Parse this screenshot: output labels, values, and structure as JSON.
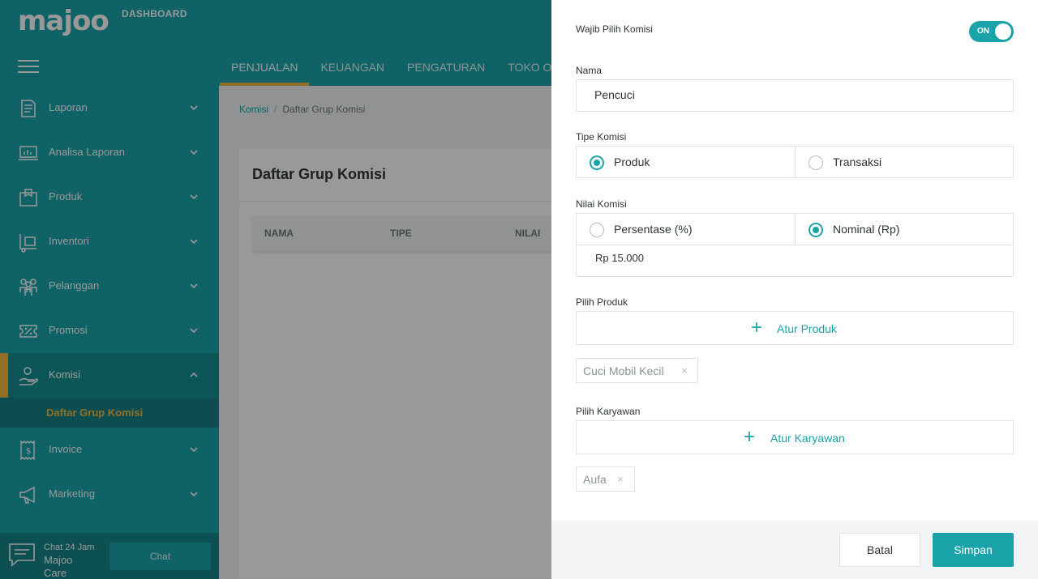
{
  "brand": {
    "logo": "majoo",
    "subtitle": "DASHBOARD"
  },
  "colors": {
    "primary": "#1aa3a8",
    "accent": "#f4b942",
    "overlay": "rgba(0,0,0,0.4)"
  },
  "topnav": [
    {
      "label": "PENJUALAN",
      "active": true
    },
    {
      "label": "KEUANGAN",
      "active": false
    },
    {
      "label": "PENGATURAN",
      "active": false
    },
    {
      "label": "TOKO ONL",
      "active": false
    }
  ],
  "sidebar": {
    "items": [
      {
        "label": "Laporan",
        "icon": "report-icon"
      },
      {
        "label": "Analisa Laporan",
        "icon": "analytics-icon"
      },
      {
        "label": "Produk",
        "icon": "box-icon"
      },
      {
        "label": "Inventori",
        "icon": "inventory-icon"
      },
      {
        "label": "Pelanggan",
        "icon": "customers-icon"
      },
      {
        "label": "Promosi",
        "icon": "coupon-icon"
      },
      {
        "label": "Komisi",
        "icon": "commission-icon",
        "active": true
      },
      {
        "label": "Invoice",
        "icon": "invoice-icon"
      },
      {
        "label": "Marketing",
        "icon": "megaphone-icon"
      }
    ],
    "submenu": {
      "label": "Daftar Grup Komisi"
    },
    "chat": {
      "line1": "Chat 24 Jam",
      "line2": "Majoo Care",
      "button": "Chat"
    }
  },
  "main": {
    "breadcrumb": {
      "link": "Komisi",
      "separator": "/",
      "current": "Daftar Grup Komisi"
    },
    "title": "Daftar Grup Komisi",
    "columns": [
      "NAMA",
      "TIPE",
      "NILAI"
    ]
  },
  "drawer": {
    "required": {
      "label": "Wajib Pilih Komisi",
      "toggle": "ON"
    },
    "name": {
      "label": "Nama",
      "value": "Pencuci"
    },
    "tipe": {
      "label": "Tipe Komisi",
      "options": [
        "Produk",
        "Transaksi"
      ],
      "selected": "Produk"
    },
    "nilai": {
      "label": "Nilai Komisi",
      "options": [
        "Persentase (%)",
        "Nominal (Rp)"
      ],
      "selected": "Nominal (Rp)",
      "value": "Rp 15.000"
    },
    "produk": {
      "label": "Pilih Produk",
      "button": "Atur Produk",
      "chips": [
        "Cuci Mobil Kecil"
      ]
    },
    "karyawan": {
      "label": "Pilih Karyawan",
      "button": "Atur Karyawan",
      "chips": [
        "Aufa"
      ]
    },
    "chip_close": "×",
    "footer": {
      "cancel": "Batal",
      "save": "Simpan"
    }
  }
}
